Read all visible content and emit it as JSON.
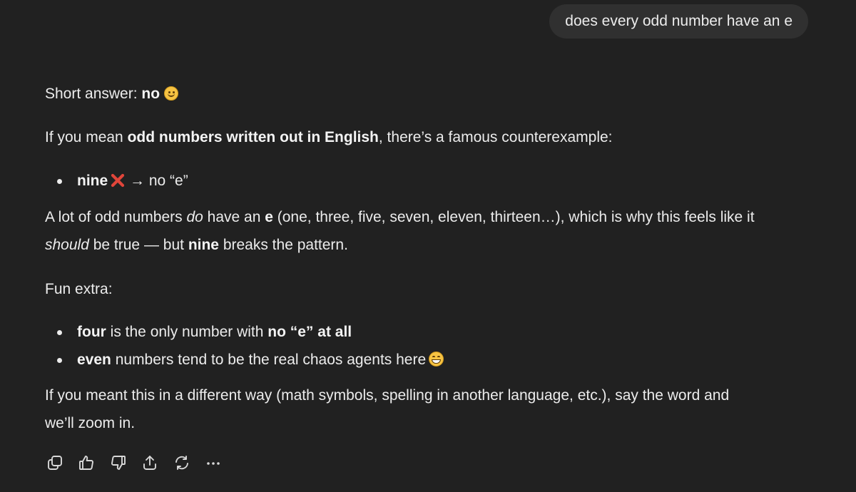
{
  "user_message": "does every odd number have an e",
  "assistant": {
    "p1": {
      "prefix": "Short answer: ",
      "bold": "no",
      "emoji": "slightly-smiling-face-icon"
    },
    "p2": {
      "prefix": "If you mean ",
      "bold": "odd numbers written out in English",
      "suffix": ", there’s a famous counterexample:"
    },
    "bullet1": {
      "bold": "nine",
      "emoji": "cross-mark-icon",
      "suffix": " → no “e”"
    },
    "p3": {
      "line1_a": "A lot of odd numbers ",
      "line1_italic": "do",
      "line1_b": " have an ",
      "line1_bold": "e",
      "line1_c": " (one, three, five, seven, eleven, thirteen…), which is why this feels like it",
      "line2_italic": "should",
      "line2_a": " be true — but ",
      "line2_bold": "nine",
      "line2_b": " breaks the pattern."
    },
    "p4": "Fun extra:",
    "bullet2": {
      "bold": "four",
      "middle": " is the only number with ",
      "bold2": "no “e” at all"
    },
    "bullet3": {
      "bold": "even",
      "middle": " numbers tend to be the real chaos agents here",
      "emoji": "grinning-face-icon"
    },
    "p5": {
      "line1": "If you meant this in a different way (math symbols, spelling in another language, etc.), say the word and",
      "line2": "we’ll zoom in."
    }
  },
  "toolbar": {
    "icons": [
      "copy-icon",
      "thumbs-up-icon",
      "thumbs-down-icon",
      "share-icon",
      "regenerate-icon",
      "more-icon"
    ]
  },
  "colors": {
    "background": "#212121",
    "user_bubble": "#303030",
    "text": "#ececec",
    "cross_mark": "#e0453a"
  }
}
